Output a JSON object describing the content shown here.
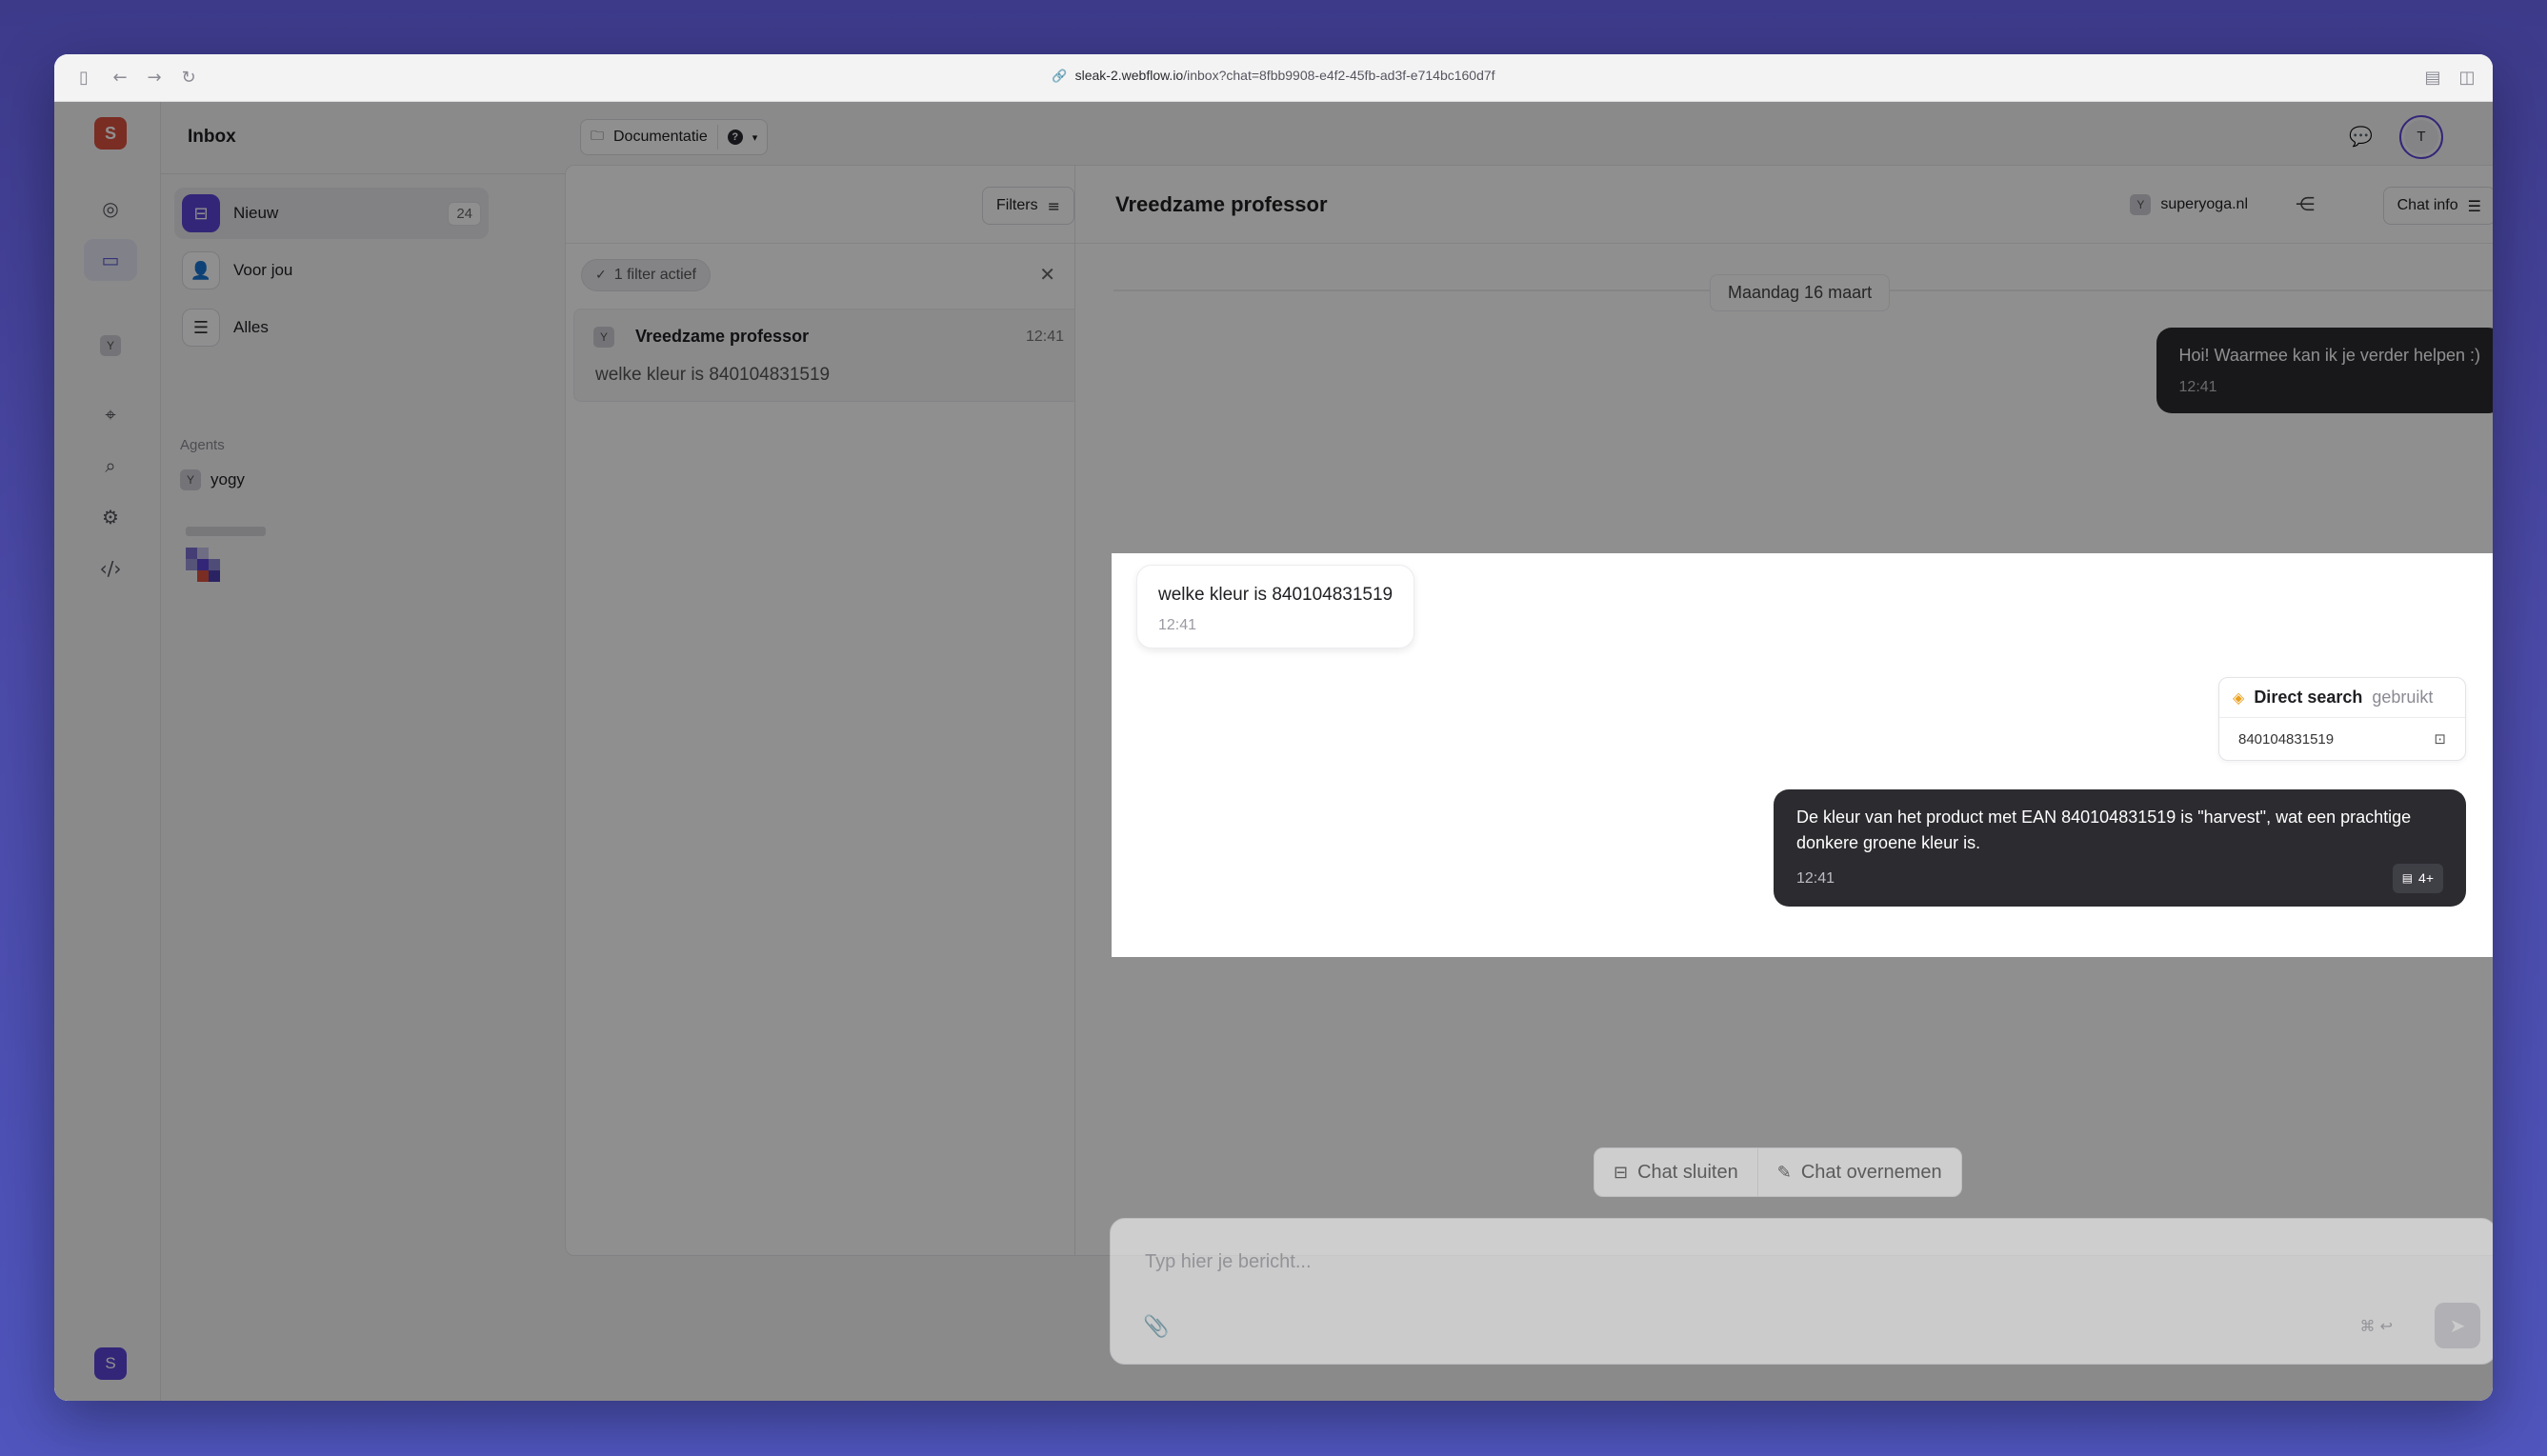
{
  "browser": {
    "url_domain": "sleak-2.webflow.io",
    "url_path": "/inbox?chat=8fbb9908-e4f2-45fb-ad3f-e714bc160d7f"
  },
  "app": {
    "logo_letter": "S",
    "page_title": "Inbox",
    "docs_label": "Documentatie",
    "user_initial": "T",
    "bottom_user_initial": "S"
  },
  "nav": {
    "items": [
      {
        "label": "Nieuw",
        "count": "24"
      },
      {
        "label": "Voor jou"
      },
      {
        "label": "Alles"
      }
    ],
    "agents_heading": "Agents",
    "agents": [
      {
        "badge": "Y",
        "name": "yogy"
      }
    ]
  },
  "list": {
    "filters_label": "Filters",
    "filter_chip": "1 filter actief",
    "conversations": [
      {
        "badge": "Y",
        "name": "Vreedzame professor",
        "time": "12:41",
        "preview": "welke kleur is 840104831519"
      }
    ]
  },
  "chat": {
    "title": "Vreedzame professor",
    "site_badge": "Y",
    "site": "superyoga.nl",
    "info_label": "Chat info",
    "date": "Maandag 16 maart",
    "messages": [
      {
        "role": "bot",
        "text": "Hoi! Waarmee kan ik je verder helpen :)",
        "time": "12:41"
      },
      {
        "role": "user",
        "text": "welke kleur is 840104831519",
        "time": "12:41"
      },
      {
        "role": "tool",
        "name": "Direct search",
        "status": "gebruikt",
        "query": "840104831519"
      },
      {
        "role": "bot",
        "text": "De kleur van het product met EAN 840104831519 is \"harvest\", wat een prachtige donkere groene kleur is.",
        "time": "12:41",
        "sources": "4+"
      }
    ],
    "close_label": "Chat sluiten",
    "takeover_label": "Chat overnemen",
    "composer_placeholder": "Typ hier je bericht...",
    "shortcut": "⌘ ↩"
  },
  "colors": {
    "accent": "#5b45d6",
    "logo": "#d9503f",
    "bot_bubble": "#2b2b30"
  }
}
